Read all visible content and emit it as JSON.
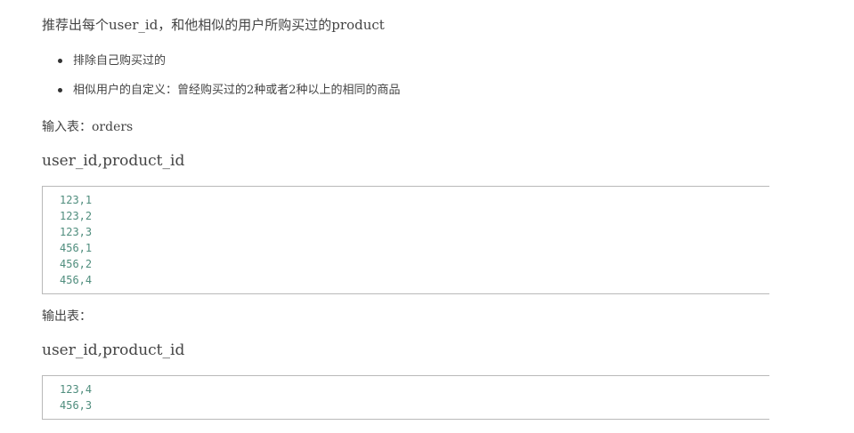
{
  "intro": "推荐出每个user_id，和他相似的用户所购买过的product",
  "rules": [
    "排除自己购买过的",
    "相似用户的自定义：曾经购买过的2种或者2种以上的相同的商品"
  ],
  "input_label": "输入表：orders",
  "input_header": "user_id,product_id",
  "input_rows": [
    "123,1",
    "123,2",
    "123,3",
    "456,1",
    "456,2",
    "456,4"
  ],
  "output_label": "输出表：",
  "output_header": "user_id,product_id",
  "output_rows": [
    "123,4",
    "456,3"
  ]
}
